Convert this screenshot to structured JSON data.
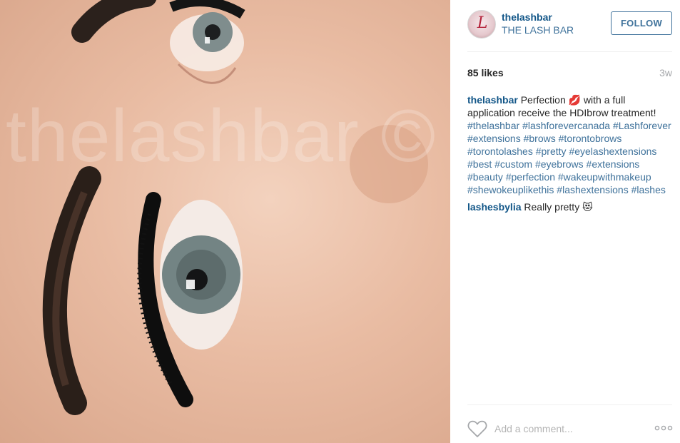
{
  "photo": {
    "watermark": "thelashbar ©"
  },
  "header": {
    "username": "thelashbar",
    "full_name": "THE LASH BAR",
    "follow_label": "FOLLOW",
    "avatar_letter": "L"
  },
  "stats": {
    "likes": "85 likes",
    "time_ago": "3w"
  },
  "caption": {
    "user": "thelashbar",
    "text": "Perfection 💋 with a full application receive the HDIbrow treatment!",
    "hashtags": [
      "#thelashbar",
      "#lashforevercanada",
      "#Lashforever",
      "#extensions",
      "#brows",
      "#torontobrows",
      "#torontolashes",
      "#pretty",
      "#eyelashextensions",
      "#best",
      "#custom",
      "#eyebrows",
      "#extensions",
      "#beauty",
      "#perfection",
      "#wakeupwithmakeup",
      "#shewokeuplikethis",
      "#lashextensions",
      "#lashes"
    ]
  },
  "comments": [
    {
      "user": "lashesbylia",
      "text": "Really pretty 😻"
    }
  ],
  "comment_box": {
    "placeholder": "Add a comment..."
  },
  "colors": {
    "link_blue": "#125688",
    "hashtag_blue": "#3f729b",
    "muted_grey": "#a5a7aa"
  },
  "icons": {
    "like": "heart-outline-icon",
    "more": "more-options-icon"
  }
}
